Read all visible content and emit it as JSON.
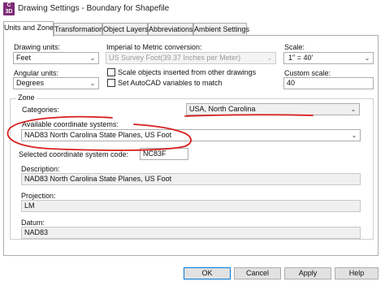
{
  "window": {
    "icon_text": "C 3D",
    "title": "Drawing Settings - Boundary for Shapefile"
  },
  "tabs": [
    {
      "label": "Units and Zone"
    },
    {
      "label": "Transformation"
    },
    {
      "label": "Object Layers"
    },
    {
      "label": "Abbreviations"
    },
    {
      "label": "Ambient Settings"
    }
  ],
  "units": {
    "drawing_units_label": "Drawing units:",
    "drawing_units_value": "Feet",
    "imperial_label": "Imperial to Metric conversion:",
    "imperial_value": "US Survey Foot(39.37 Inches per Meter)",
    "scale_label": "Scale:",
    "scale_value": "1\" = 40'",
    "angular_units_label": "Angular units:",
    "angular_units_value": "Degrees",
    "scale_objects_label": "Scale objects inserted from other drawings",
    "set_autocad_label": "Set AutoCAD variables to match",
    "custom_scale_label": "Custom scale:",
    "custom_scale_value": "40"
  },
  "zone": {
    "title": "Zone",
    "categories_label": "Categories:",
    "categories_value": "USA, North Carolina",
    "available_label": "Available coordinate systems:",
    "available_value": "NAD83 North Carolina State Planes, US Foot",
    "selected_code_label": "Selected coordinate system code:",
    "selected_code_value": "NC83F",
    "description_label": "Description:",
    "description_value": "NAD83 North Carolina State Planes, US Foot",
    "projection_label": "Projection:",
    "projection_value": "LM",
    "datum_label": "Datum:",
    "datum_value": "NAD83"
  },
  "buttons": {
    "ok": "OK",
    "cancel": "Cancel",
    "apply": "Apply",
    "help": "Help"
  },
  "colors": {
    "annotation": "#d81e1e",
    "accent": "#0078d7",
    "app_icon": "#7d2a76"
  }
}
